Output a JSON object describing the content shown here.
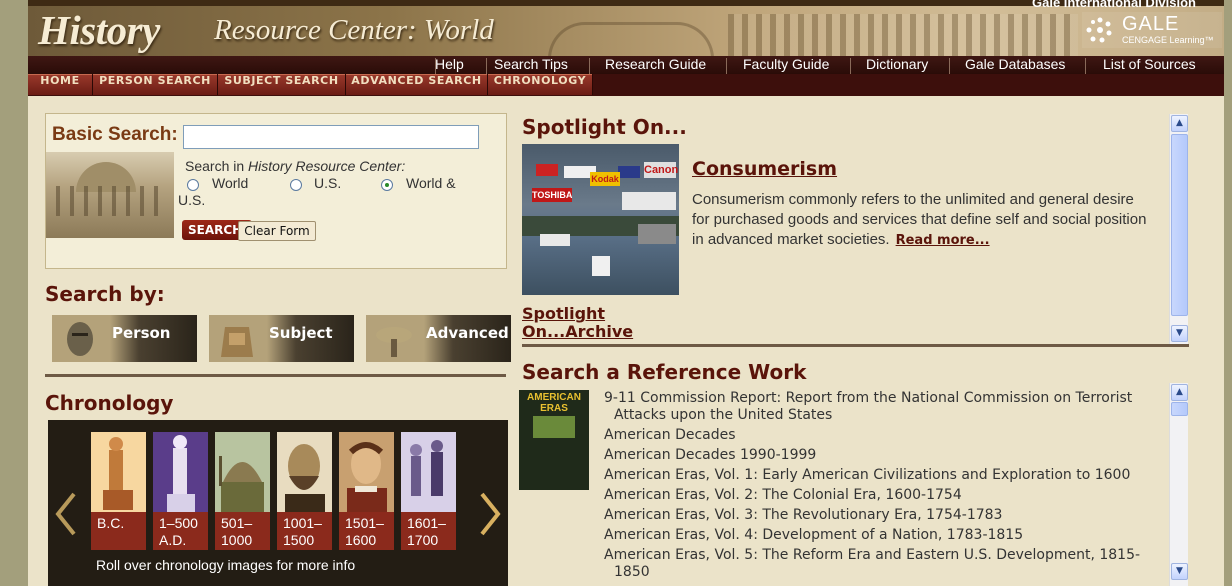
{
  "header": {
    "division": "Gale International Division",
    "title_main": "History",
    "title_sub": "Resource Center: World",
    "gale_name": "GALE",
    "gale_sub": "CENGAGE Learning™"
  },
  "utility_nav": [
    "Help",
    "Search Tips",
    "Research Guide",
    "Faculty Guide",
    "Dictionary",
    "Gale Databases",
    "List of Sources"
  ],
  "tabs": [
    "HOME",
    "PERSON SEARCH",
    "SUBJECT SEARCH",
    "ADVANCED SEARCH",
    "CHRONOLOGY"
  ],
  "basic_search": {
    "label": "Basic Search:",
    "input_value": "",
    "search_in_prefix": "Search in ",
    "search_in_name": "History Resource Center:",
    "options": [
      "World",
      "U.S.",
      "World & U.S."
    ],
    "selected": "World & U.S.",
    "search_button": "SEARCH",
    "clear_button": "Clear Form"
  },
  "search_by": {
    "heading": "Search by:",
    "buttons": [
      "Person",
      "Subject",
      "Advanced"
    ]
  },
  "chronology": {
    "heading": "Chronology",
    "items": [
      {
        "label": "B.C."
      },
      {
        "label": "1–500 A.D."
      },
      {
        "label": "501–1000"
      },
      {
        "label": "1001–1500"
      },
      {
        "label": "1501–1600"
      },
      {
        "label": "1601–1700"
      }
    ],
    "hint": "Roll over chronology images for more info"
  },
  "spotlight": {
    "heading": "Spotlight On...",
    "title": "Consumerism",
    "description": "Consumerism commonly refers to the unlimited and general desire for purchased goods and services that define self and social position in advanced market societies.",
    "read_more": "Read more...",
    "archive_line1": "Spotlight",
    "archive_line2": "On...Archive",
    "sign_texts": [
      "Canon",
      "TOSHIBA",
      "Kodak"
    ]
  },
  "reference": {
    "heading": "Search a Reference Work",
    "cover_title": "AMERICAN ERAS",
    "items": [
      "9-11 Commission Report: Report from the National Commission on Terrorist Attacks upon the United States",
      "American Decades",
      "American Decades 1990-1999",
      "American Eras, Vol. 1: Early American Civilizations and Exploration to 1600",
      "American Eras, Vol. 2: The Colonial Era, 1600-1754",
      "American Eras, Vol. 3: The Revolutionary Era, 1754-1783",
      "American Eras, Vol. 4: Development of a Nation, 1783-1815",
      "American Eras, Vol. 5: The Reform Era and Eastern U.S. Development, 1815-1850"
    ]
  }
}
